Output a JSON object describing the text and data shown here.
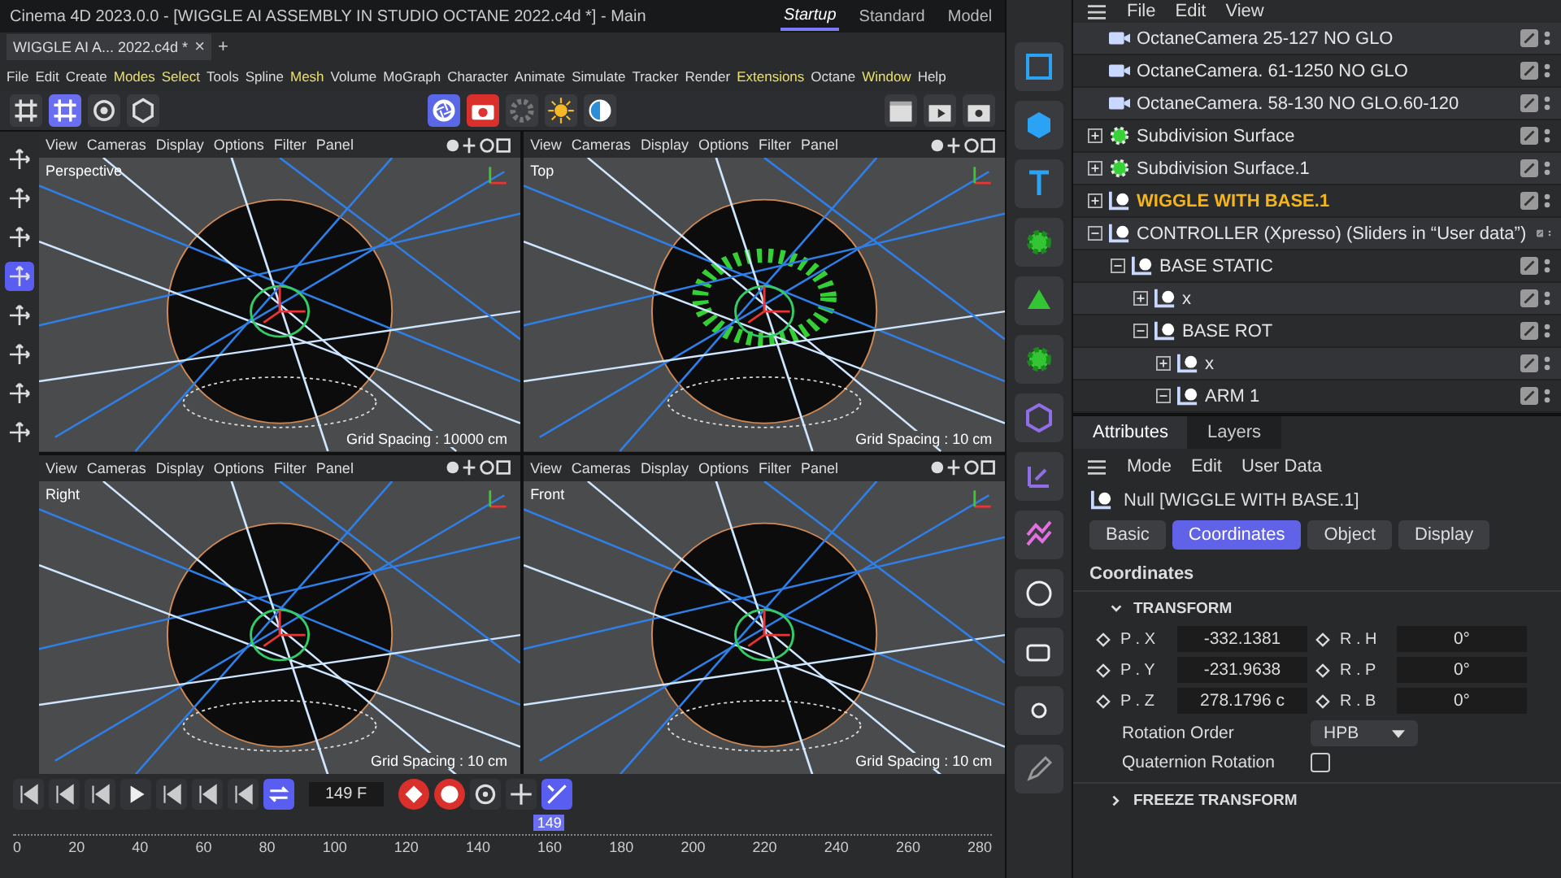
{
  "window": {
    "title": "Cinema 4D 2023.0.0 - [WIGGLE AI ASSEMBLY IN STUDIO OCTANE 2022.c4d *] - Main"
  },
  "doc_tabs": [
    {
      "label": "WIGGLE AI A... 2022.c4d *",
      "selected": true,
      "close": "×"
    }
  ],
  "new_tab": "+",
  "layouts": [
    {
      "label": "Startup",
      "selected": true
    },
    {
      "label": "Standard",
      "selected": false
    },
    {
      "label": "Model",
      "selected": false
    }
  ],
  "menu": [
    {
      "label": "File",
      "highlighted": false
    },
    {
      "label": "Edit",
      "highlighted": false
    },
    {
      "label": "Create",
      "highlighted": false
    },
    {
      "label": "Modes",
      "highlighted": true
    },
    {
      "label": "Select",
      "highlighted": true
    },
    {
      "label": "Tools",
      "highlighted": false
    },
    {
      "label": "Spline",
      "highlighted": false
    },
    {
      "label": "Mesh",
      "highlighted": true
    },
    {
      "label": "Volume",
      "highlighted": false
    },
    {
      "label": "MoGraph",
      "highlighted": false
    },
    {
      "label": "Character",
      "highlighted": false
    },
    {
      "label": "Animate",
      "highlighted": false
    },
    {
      "label": "Simulate",
      "highlighted": false
    },
    {
      "label": "Tracker",
      "highlighted": false
    },
    {
      "label": "Render",
      "highlighted": false
    },
    {
      "label": "Extensions",
      "highlighted": true
    },
    {
      "label": "Octane",
      "highlighted": false
    },
    {
      "label": "Window",
      "highlighted": true
    },
    {
      "label": "Help",
      "highlighted": false
    }
  ],
  "viewports": [
    {
      "name": "Perspective",
      "menu": [
        "View",
        "Cameras",
        "Display",
        "Options",
        "Filter",
        "Panel"
      ],
      "grid": "Grid Spacing : 10000 cm"
    },
    {
      "name": "Top",
      "menu": [
        "View",
        "Cameras",
        "Display",
        "Options",
        "Filter",
        "Panel"
      ],
      "grid": "Grid Spacing : 10 cm"
    },
    {
      "name": "Right",
      "menu": [
        "View",
        "Cameras",
        "Display",
        "Options",
        "Filter",
        "Panel"
      ],
      "grid": "Grid Spacing : 10 cm"
    },
    {
      "name": "Front",
      "menu": [
        "View",
        "Cameras",
        "Display",
        "Options",
        "Filter",
        "Panel"
      ],
      "grid": "Grid Spacing : 10 cm"
    }
  ],
  "timeline": {
    "ticks": [
      "0",
      "20",
      "40",
      "60",
      "80",
      "100",
      "120",
      "140",
      "160",
      "180",
      "200",
      "220",
      "240",
      "260",
      "280"
    ],
    "current_frame": "149",
    "level": 0.532,
    "frame_field": "149 F"
  },
  "objects": {
    "menu": [
      "File",
      "Edit",
      "View"
    ],
    "tree": [
      {
        "name": "OctaneCamera 25-127 NO GLO",
        "kind": "camera",
        "selected": false
      },
      {
        "name": "OctaneCamera. 61-1250 NO GLO",
        "kind": "camera",
        "selected": false
      },
      {
        "name": "OctaneCamera. 58-130 NO GLO.60-120",
        "kind": "camera",
        "selected": false
      },
      {
        "name": "Subdivision Surface",
        "kind": "subdivision",
        "expanded": false,
        "selected": false
      },
      {
        "name": "Subdivision Surface.1",
        "kind": "subdivision",
        "expanded": false,
        "selected": false
      },
      {
        "name": "WIGGLE  WITH BASE.1",
        "kind": "null",
        "expanded": false,
        "selected": true
      },
      {
        "name": "CONTROLLER (Xpresso) (Sliders in “User data”)",
        "kind": "null",
        "expanded": true,
        "selected": false,
        "children": [
          {
            "name": "BASE STATIC",
            "kind": "null",
            "expanded": true,
            "selected": false,
            "children": [
              {
                "name": "x",
                "kind": "null",
                "expanded": false,
                "selected": false
              },
              {
                "name": "BASE ROT",
                "kind": "null",
                "expanded": true,
                "selected": false,
                "children": [
                  {
                    "name": "x",
                    "kind": "null",
                    "expanded": false,
                    "selected": false
                  },
                  {
                    "name": "ARM 1",
                    "kind": "null",
                    "expanded": true,
                    "selected": false
                  }
                ]
              }
            ]
          }
        ]
      }
    ]
  },
  "attributes": {
    "tabs": [
      {
        "label": "Attributes",
        "selected": true
      },
      {
        "label": "Layers",
        "selected": false
      }
    ],
    "menu": [
      "Mode",
      "Edit",
      "User Data"
    ],
    "object": "Null [WIGGLE  WITH BASE.1]",
    "pages": [
      {
        "label": "Basic",
        "selected": false
      },
      {
        "label": "Coordinates",
        "selected": true
      },
      {
        "label": "Object",
        "selected": false
      },
      {
        "label": "Display",
        "selected": false
      }
    ],
    "heading": "Coordinates",
    "transform": {
      "title": "TRANSFORM",
      "expanded": true
    },
    "position": [
      {
        "label": "P . X",
        "value": "-332.1381"
      },
      {
        "label": "P . Y",
        "value": "-231.9638"
      },
      {
        "label": "P . Z",
        "value": "278.1796 c"
      }
    ],
    "rotation": [
      {
        "label": "R . H",
        "value": "0°"
      },
      {
        "label": "R . P",
        "value": "0°"
      },
      {
        "label": "R . B",
        "value": "0°"
      }
    ],
    "rotation_order": {
      "label": "Rotation Order",
      "value": "HPB"
    },
    "quaternion": {
      "label": "Quaternion Rotation",
      "checked": false
    },
    "freeze": {
      "title": "FREEZE TRANSFORM",
      "expanded": false
    }
  }
}
